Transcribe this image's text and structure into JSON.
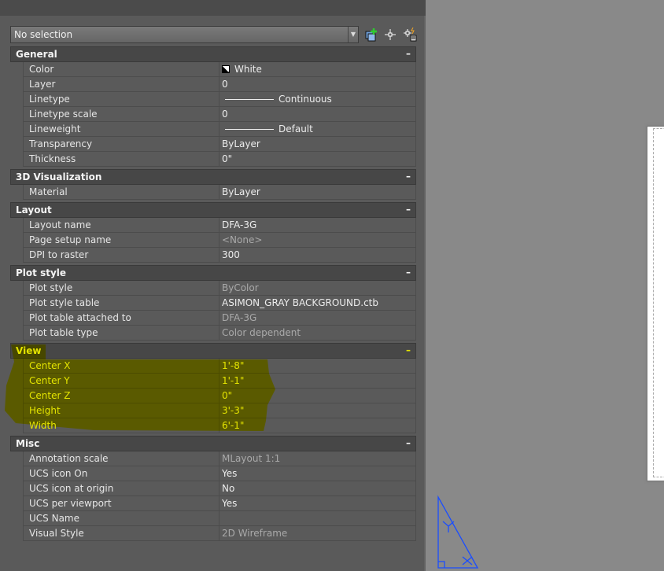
{
  "selection": {
    "value": "No selection"
  },
  "toolbar": [
    {
      "icon": "quick-select-icon"
    },
    {
      "icon": "select-objects-icon"
    },
    {
      "icon": "toggle-pickadd-icon"
    }
  ],
  "sections": [
    {
      "title": "General",
      "collapse": "–",
      "rows": [
        {
          "label": "Color",
          "value": "White",
          "swatch": true
        },
        {
          "label": "Layer",
          "value": "0"
        },
        {
          "label": "Linetype",
          "value": "Continuous",
          "line": true
        },
        {
          "label": "Linetype scale",
          "value": "0"
        },
        {
          "label": "Lineweight",
          "value": "Default",
          "line": true
        },
        {
          "label": "Transparency",
          "value": "ByLayer"
        },
        {
          "label": "Thickness",
          "value": "0\""
        }
      ]
    },
    {
      "title": "3D Visualization",
      "collapse": "–",
      "rows": [
        {
          "label": "Material",
          "value": "ByLayer"
        }
      ]
    },
    {
      "title": "Layout",
      "collapse": "–",
      "rows": [
        {
          "label": "Layout name",
          "value": "DFA-3G"
        },
        {
          "label": "Page setup name",
          "value": "<None>",
          "dim": true
        },
        {
          "label": "DPI to raster",
          "value": "300"
        }
      ]
    },
    {
      "title": "Plot style",
      "collapse": "–",
      "rows": [
        {
          "label": "Plot style",
          "value": "ByColor",
          "dim": true
        },
        {
          "label": "Plot style table",
          "value": "ASIMON_GRAY BACKGROUND.ctb"
        },
        {
          "label": "Plot table attached to",
          "value": "DFA-3G",
          "dim": true
        },
        {
          "label": "Plot table type",
          "value": "Color dependent",
          "dim": true
        }
      ]
    },
    {
      "title": "View",
      "collapse": "–",
      "highlight": true,
      "rows": [
        {
          "label": "Center X",
          "value": "1'-8\""
        },
        {
          "label": "Center Y",
          "value": "1'-1\""
        },
        {
          "label": "Center Z",
          "value": "0\""
        },
        {
          "label": "Height",
          "value": "3'-3\""
        },
        {
          "label": "Width",
          "value": "6'-1\""
        }
      ]
    },
    {
      "title": "Misc",
      "collapse": "–",
      "rows": [
        {
          "label": "Annotation scale",
          "value": "MLayout 1:1",
          "dim": true
        },
        {
          "label": "UCS icon On",
          "value": "Yes"
        },
        {
          "label": "UCS icon at origin",
          "value": "No"
        },
        {
          "label": "UCS per viewport",
          "value": "Yes"
        },
        {
          "label": "UCS Name",
          "value": ""
        },
        {
          "label": "Visual Style",
          "value": "2D Wireframe",
          "dim": true
        }
      ]
    }
  ],
  "colors": {
    "highlight": "#e4e400",
    "ucs": "#1a4dff"
  }
}
